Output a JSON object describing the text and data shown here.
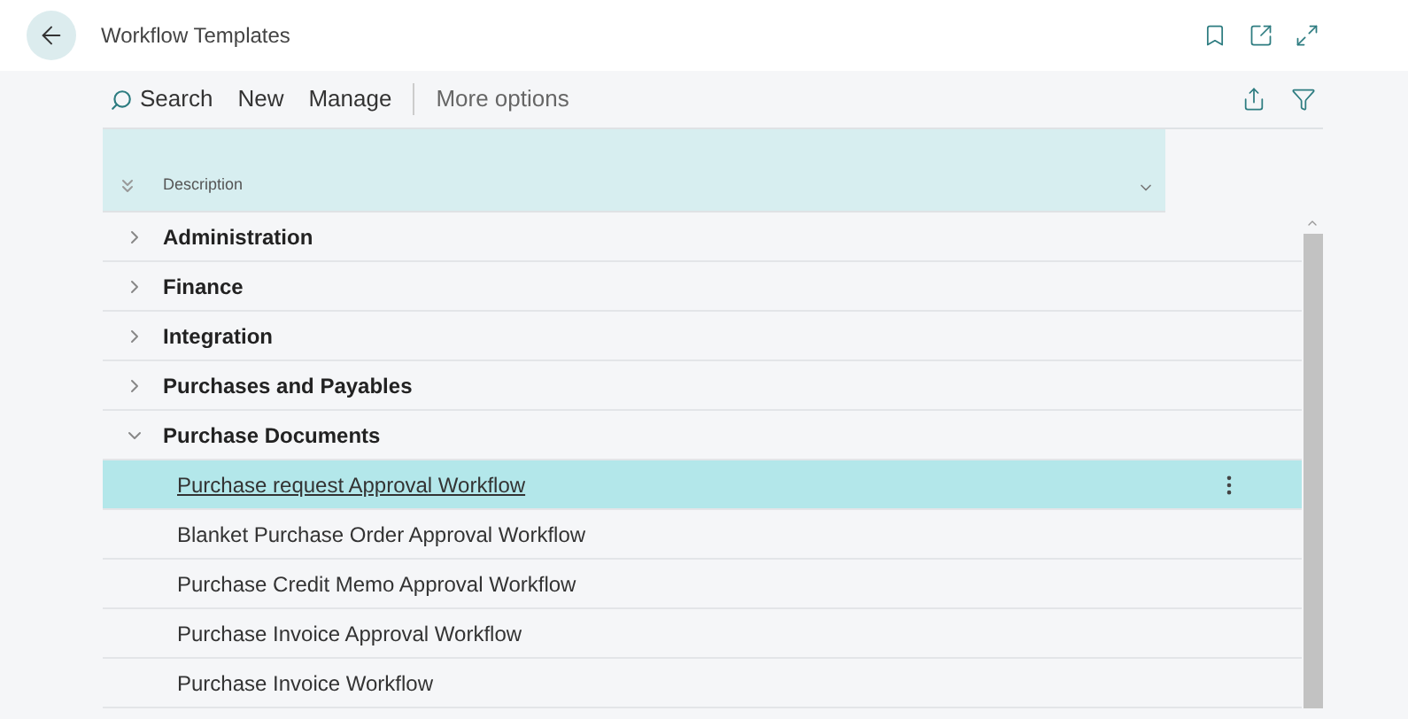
{
  "page": {
    "title": "Workflow Templates"
  },
  "toolbar": {
    "actions": [
      "Search",
      "New",
      "Manage"
    ],
    "more": "More options"
  },
  "table": {
    "column": "Description",
    "groups": [
      {
        "label": "Administration",
        "expanded": false
      },
      {
        "label": "Finance",
        "expanded": false
      },
      {
        "label": "Integration",
        "expanded": false
      },
      {
        "label": "Purchases and Payables",
        "expanded": false
      },
      {
        "label": "Purchase Documents",
        "expanded": true,
        "children": [
          {
            "label": "Purchase request Approval Workflow",
            "selected": true
          },
          {
            "label": "Blanket Purchase Order Approval Workflow",
            "selected": false
          },
          {
            "label": "Purchase Credit Memo Approval Workflow",
            "selected": false
          },
          {
            "label": "Purchase Invoice Approval Workflow",
            "selected": false
          },
          {
            "label": "Purchase Invoice Workflow",
            "selected": false
          }
        ]
      }
    ]
  }
}
